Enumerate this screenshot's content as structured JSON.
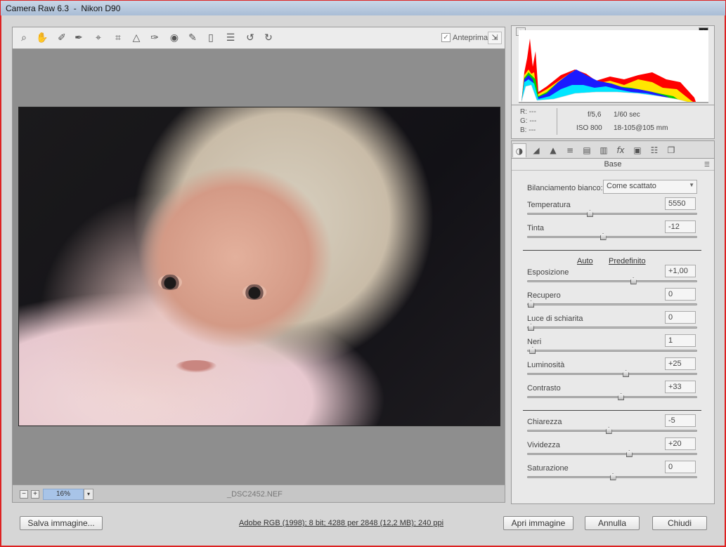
{
  "window": {
    "title": "Camera Raw 6.3  -  Nikon D90"
  },
  "toolbar": {
    "tools": [
      "zoom-tool-icon",
      "hand-tool-icon",
      "white-balance-tool-icon",
      "color-sampler-tool-icon",
      "targeted-adjustment-tool-icon",
      "crop-tool-icon",
      "straighten-tool-icon",
      "spot-removal-tool-icon",
      "red-eye-tool-icon",
      "adjustment-brush-icon",
      "graduated-filter-icon",
      "preferences-icon",
      "rotate-ccw-icon",
      "rotate-cw-icon"
    ],
    "preview_checked": true,
    "preview_label": "Anteprima"
  },
  "statusbar": {
    "zoom_value": "16%",
    "filename": "_DSC2452.NEF"
  },
  "histogram": {
    "r": "---",
    "g": "---",
    "b": "---",
    "r_label": "R:",
    "g_label": "G:",
    "b_label": "B:"
  },
  "exif": {
    "aperture": "f/5,6",
    "shutter": "1/60 sec",
    "iso": "ISO 800",
    "lens": "18-105@105 mm"
  },
  "panel": {
    "title": "Base",
    "wb_label": "Bilanciamento bianco:",
    "wb_value": "Come scattato",
    "auto_label": "Auto",
    "default_label": "Predefinito",
    "sliders": {
      "temperatura": {
        "label": "Temperatura",
        "value": "5550",
        "pos": 0.36
      },
      "tinta": {
        "label": "Tinta",
        "value": "-12",
        "pos": 0.44
      },
      "esposizione": {
        "label": "Esposizione",
        "value": "+1,00",
        "pos": 0.625
      },
      "recupero": {
        "label": "Recupero",
        "value": "0",
        "pos": 0.0
      },
      "luce": {
        "label": "Luce di schiarita",
        "value": "0",
        "pos": 0.0
      },
      "neri": {
        "label": "Neri",
        "value": "1",
        "pos": 0.01
      },
      "luminosita": {
        "label": "Luminosità",
        "value": "+25",
        "pos": 0.58
      },
      "contrasto": {
        "label": "Contrasto",
        "value": "+33",
        "pos": 0.55
      },
      "chiarezza": {
        "label": "Chiarezza",
        "value": "-5",
        "pos": 0.475
      },
      "vividezza": {
        "label": "Vividezza",
        "value": "+20",
        "pos": 0.6
      },
      "saturazione": {
        "label": "Saturazione",
        "value": "0",
        "pos": 0.5
      }
    }
  },
  "footer": {
    "save_label": "Salva immagine...",
    "workflow_text": "Adobe RGB (1998); 8 bit; 4288 per 2848 (12,2 MB); 240 ppi",
    "open_label": "Apri immagine",
    "cancel_label": "Annulla",
    "close_label": "Chiudi"
  }
}
